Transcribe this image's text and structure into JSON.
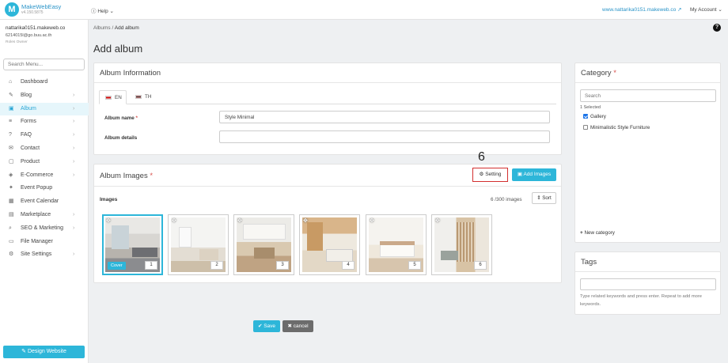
{
  "topbar": {
    "logo_letter": "M",
    "brand": "MakeWebEasy",
    "version": "v4.150.5875",
    "help": "Help",
    "site_link": "www.nattarika0151.makeweb.co",
    "account": "My Account"
  },
  "user": {
    "name": "nattarika0151.makeweb.co",
    "email": "6214015l@go.buu.ac.th",
    "role": "Roles Owner"
  },
  "menu_search_placeholder": "Search Menu...",
  "menu": [
    {
      "label": "Dashboard",
      "icon": "home-icon",
      "has_arrow": false
    },
    {
      "label": "Blog",
      "icon": "edit-icon",
      "has_arrow": true
    },
    {
      "label": "Album",
      "icon": "image-icon",
      "has_arrow": true,
      "active": true
    },
    {
      "label": "Forms",
      "icon": "list-icon",
      "has_arrow": true
    },
    {
      "label": "FAQ",
      "icon": "question-icon",
      "has_arrow": true
    },
    {
      "label": "Contact",
      "icon": "mail-icon",
      "has_arrow": true
    },
    {
      "label": "Product",
      "icon": "box-icon",
      "has_arrow": true
    },
    {
      "label": "E-Commerce",
      "icon": "tag-icon",
      "has_arrow": true
    },
    {
      "label": "Event Popup",
      "icon": "megaphone-icon",
      "has_arrow": false
    },
    {
      "label": "Event Calendar",
      "icon": "calendar-icon",
      "has_arrow": false
    },
    {
      "label": "Marketplace",
      "icon": "store-icon",
      "has_arrow": true
    },
    {
      "label": "SEO & Marketing",
      "icon": "search-icon",
      "has_arrow": true
    },
    {
      "label": "File Manager",
      "icon": "folder-icon",
      "has_arrow": false
    },
    {
      "label": "Site Settings",
      "icon": "gear-icon",
      "has_arrow": true
    }
  ],
  "design_button": "Design Website",
  "breadcrumb": {
    "parent": "Albums",
    "separator": "/",
    "current": "Add album"
  },
  "page_title": "Add album",
  "album_info": {
    "title": "Album Information",
    "tabs": [
      "EN",
      "TH"
    ],
    "name_label": "Album name",
    "name_required": "*",
    "name_value": "Style Minimal",
    "details_label": "Album details",
    "details_value": ""
  },
  "album_images": {
    "title": "Album Images",
    "required": "*",
    "step_number": "6",
    "setting_label": "Setting",
    "add_images_label": "Add Images",
    "images_label": "Images",
    "count_text": "6 /300 images",
    "sort_label": "Sort",
    "cover_label": "Cover",
    "thumbnails": [
      "1",
      "2",
      "3",
      "4",
      "5",
      "6"
    ]
  },
  "actions": {
    "save": "Save",
    "cancel": "cancel"
  },
  "category": {
    "title": "Category",
    "required": "*",
    "search_placeholder": "Search",
    "selected_text": "1 Selected",
    "items": [
      {
        "label": "Gallery",
        "checked": true
      },
      {
        "label": "Minimalistic Style Furniture",
        "checked": false
      }
    ],
    "new_category": "New category"
  },
  "tags": {
    "title": "Tags",
    "hint": "Type related keywords and press enter. Repeat to add more keywords."
  },
  "colors": {
    "accent": "#2db6d9",
    "highlight": "#d32f2f",
    "active_bg": "#e6f6fb"
  }
}
